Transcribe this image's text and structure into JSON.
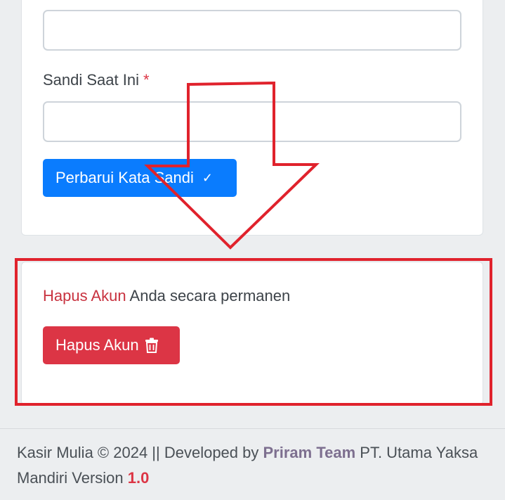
{
  "password_form": {
    "top_input_value": "",
    "current_password_label": "Sandi Saat Ini",
    "required_marker": "*",
    "current_password_value": "",
    "update_button_label": "Perbarui Kata Sandi",
    "update_button_icon": "check-icon"
  },
  "delete_account": {
    "highlight_text": "Hapus Akun",
    "description_rest": " Anda secara permanen",
    "delete_button_label": "Hapus Akun",
    "delete_button_icon": "trash-icon"
  },
  "annotations": {
    "highlight_color": "#e0222c",
    "arrow_icon": "arrow-down-outline"
  },
  "footer": {
    "prefix": "Kasir Mulia © 2024 || Developed by ",
    "team": "Priram Team",
    "middle": " PT. Utama Yaksa Mandiri Version ",
    "version": "1.0"
  },
  "colors": {
    "primary": "#0a7cfe",
    "danger": "#dc3545",
    "background": "#eceef0"
  }
}
